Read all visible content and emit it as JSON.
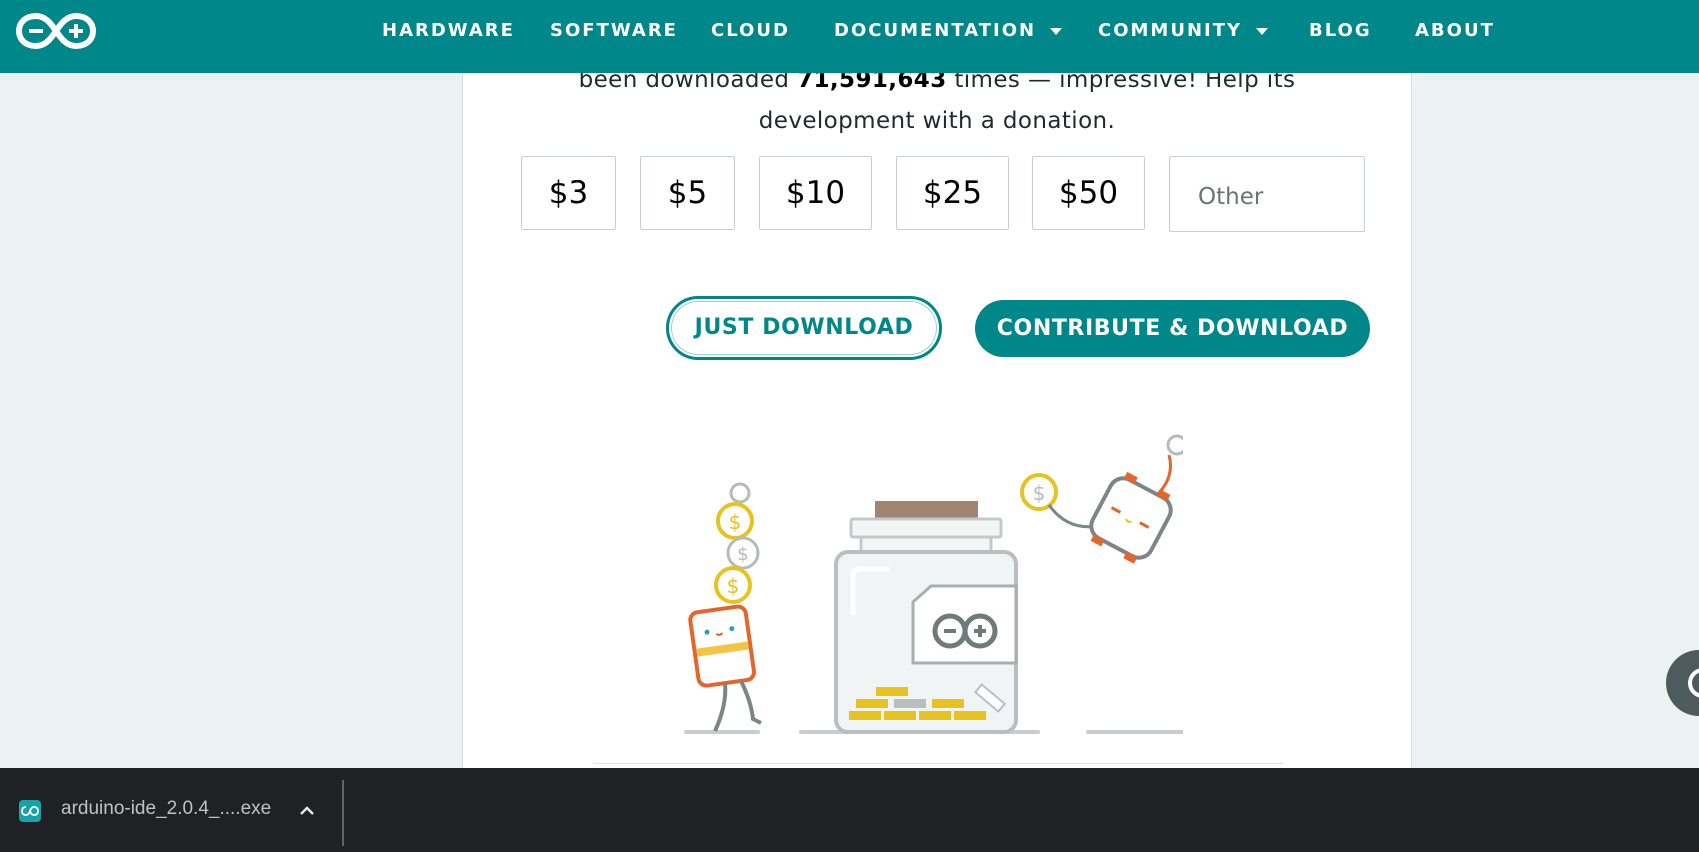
{
  "nav": {
    "items": [
      {
        "label": "HARDWARE"
      },
      {
        "label": "SOFTWARE"
      },
      {
        "label": "CLOUD"
      },
      {
        "label": "DOCUMENTATION"
      },
      {
        "label": "COMMUNITY"
      },
      {
        "label": "BLOG"
      },
      {
        "label": "ABOUT"
      }
    ],
    "logo_icon": "arduino-logo-icon"
  },
  "donation": {
    "text_before": "been downloaded",
    "download_count": "71,591,643",
    "text_after": "times — impressive! Help its",
    "text_line2": "development with a donation.",
    "amounts": [
      "$3",
      "$5",
      "$10",
      "$25",
      "$50"
    ],
    "other_placeholder": "Other"
  },
  "buttons": {
    "just_download": "JUST DOWNLOAD",
    "contribute_download": "CONTRIBUTE & DOWNLOAD"
  },
  "colors": {
    "brand_teal": "#00878a",
    "coin_yellow": "#e8c21f",
    "robot_orange": "#e4662c"
  },
  "download_bar": {
    "file_name": "arduino-ide_2.0.4_....exe",
    "file_icon": "arduino-file-icon",
    "expand_icon": "chevron-up-icon"
  }
}
